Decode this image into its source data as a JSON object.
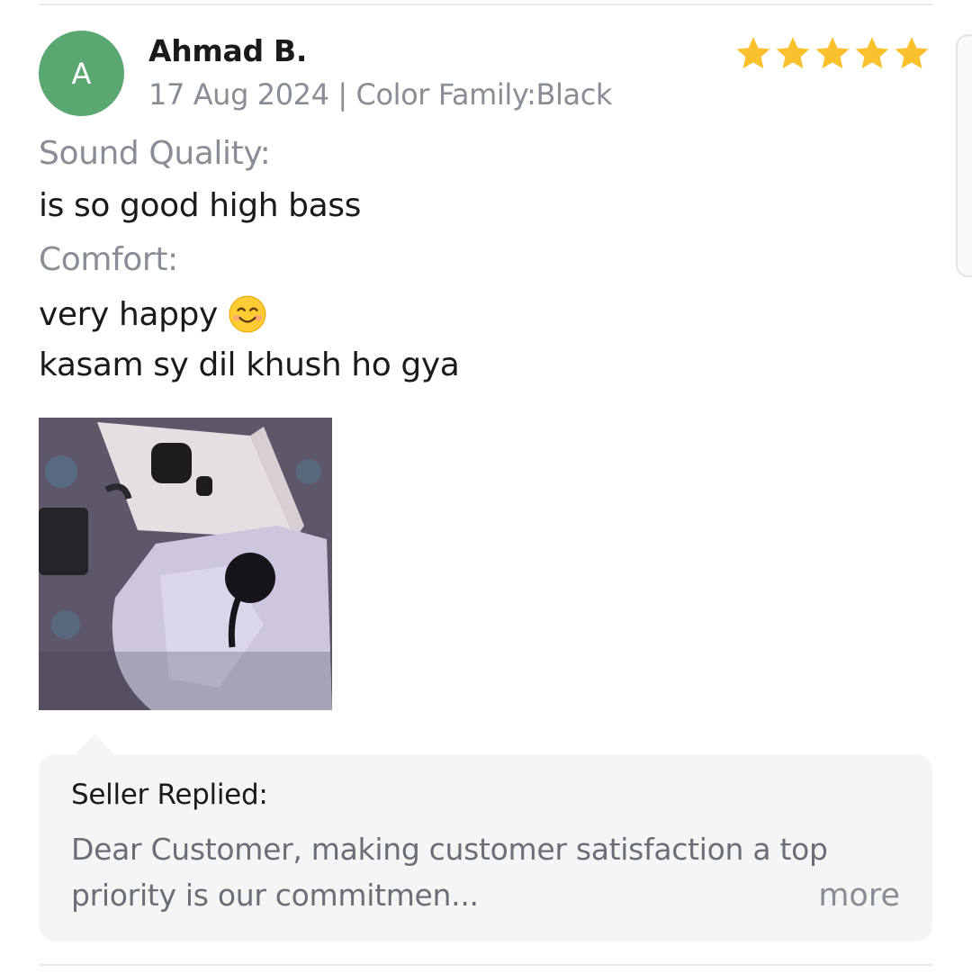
{
  "review": {
    "avatar_initial": "A",
    "reviewer_name": "Ahmad B.",
    "meta": "17 Aug 2024 | Color Family:Black",
    "rating": 5,
    "sections": {
      "sound_quality_label": "Sound Quality:",
      "sound_quality_text": "is so good high bass",
      "comfort_label": "Comfort:",
      "comfort_text_line1": "very happy",
      "comfort_text_line2": "kasam sy dil khush ho gya"
    }
  },
  "seller_reply": {
    "title": "Seller Replied:",
    "line1": "Dear Customer, making customer satisfaction a top",
    "line2": "priority is our commitmen...",
    "more_label": "more"
  },
  "colors": {
    "star": "#fbc02d",
    "avatar": "#5aa772",
    "muted_text": "#8a8d95",
    "reply_background": "#f5f5f5"
  },
  "icons": [
    "star-icon",
    "smiling-face-emoji"
  ]
}
